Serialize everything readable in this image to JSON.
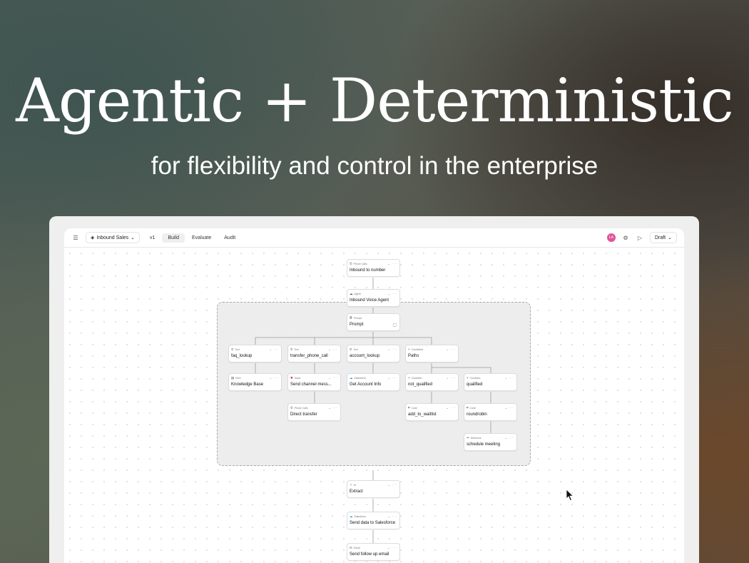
{
  "hero": {
    "title": "Agentic + Deterministic",
    "subtitle": "for flexibility and control in the enterprise"
  },
  "toolbar": {
    "project": "Inbound Sales",
    "version": "v1",
    "tabs": [
      "Build",
      "Evaluate",
      "Audit"
    ],
    "active_tab": "Build",
    "avatar_initials": "LA",
    "status": "Draft"
  },
  "colors": {
    "avatar": "#e0559a",
    "accent": "#1f9bd7"
  },
  "nodes": [
    {
      "id": "n1",
      "type": "Phone Calls",
      "icon": "phone-icon",
      "title": "Inbound to number"
    },
    {
      "id": "n2",
      "type": "Agent",
      "icon": "agent-icon",
      "title": "Inbound Voice Agent"
    },
    {
      "id": "n3",
      "type": "Prompt",
      "icon": "prompt-icon",
      "title": "Prompt"
    },
    {
      "id": "n4",
      "type": "Tool",
      "icon": "tool-icon",
      "title": "faq_lookup"
    },
    {
      "id": "n5",
      "type": "Tool",
      "icon": "tool-icon",
      "title": "transfer_phone_call"
    },
    {
      "id": "n6",
      "type": "Tool",
      "icon": "tool-icon",
      "title": "account_lookup"
    },
    {
      "id": "n7",
      "type": "Conditions",
      "icon": "branch-icon",
      "title": "Paths"
    },
    {
      "id": "n8",
      "type": "RAG",
      "icon": "database-icon",
      "title": "Knowledge Base"
    },
    {
      "id": "n9",
      "type": "Slack",
      "icon": "slack-icon",
      "title": "Send channel mess..."
    },
    {
      "id": "n10",
      "type": "Salesforce",
      "icon": "salesforce-icon",
      "title": "Get Account Info"
    },
    {
      "id": "n11",
      "type": "Condition",
      "icon": "branch-icon",
      "title": "not_qualified"
    },
    {
      "id": "n12",
      "type": "Condition",
      "icon": "branch-icon",
      "title": "qualified"
    },
    {
      "id": "n13",
      "type": "Phone Calls",
      "icon": "phone-icon",
      "title": "Direct transfer"
    },
    {
      "id": "n14",
      "type": "Code",
      "icon": "code-icon",
      "title": "add_to_waitlist"
    },
    {
      "id": "n15",
      "type": "Code",
      "icon": "code-icon",
      "title": "roundrobin"
    },
    {
      "id": "n16",
      "type": "Webhook",
      "icon": "webhook-icon",
      "title": "schedule meeting"
    },
    {
      "id": "n17",
      "type": "AI",
      "icon": "sparkle-icon",
      "title": "Extract"
    },
    {
      "id": "n18",
      "type": "Salesforce",
      "icon": "salesforce-icon",
      "title": "Send data to Salesforce"
    },
    {
      "id": "n19",
      "type": "Email",
      "icon": "email-icon",
      "title": "Send follow up email"
    }
  ]
}
